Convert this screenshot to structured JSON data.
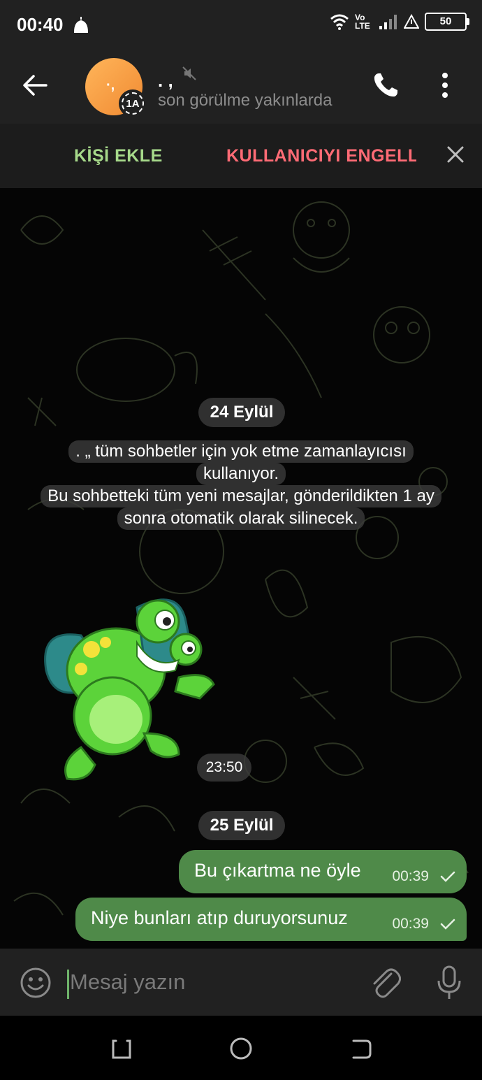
{
  "status_bar": {
    "time": "00:40",
    "network": "Vo LTE",
    "battery": "50"
  },
  "header": {
    "contact_name": ". ,",
    "avatar_initials": "·,",
    "timer_label": "1A",
    "status": "son görülme yakınlarda"
  },
  "action_bar": {
    "add_contact": "KİŞİ EKLE",
    "block_user": "KULLANICIYI ENGELLE"
  },
  "chat": {
    "date_1": "24 Eylül",
    "system_message_lines": [
      ". „ tüm sohbetler için yok etme zamanlayıcısı",
      "kullanıyor.",
      "Bu sohbetteki tüm yeni mesajlar, gönderildikten 1 ay",
      "sonra otomatik olarak silinecek."
    ],
    "sticker_time": "23:50",
    "date_2": "25 Eylül",
    "messages": [
      {
        "text": "Bu çıkartma ne öyle",
        "time": "00:39",
        "status": "sent"
      },
      {
        "text": "Niye bunları atıp duruyorsunuz",
        "time": "00:39",
        "status": "sent"
      }
    ]
  },
  "composer": {
    "placeholder": "Mesaj yazın"
  },
  "colors": {
    "bubble_out": "#4f8a49",
    "add_contact": "#a6d98a",
    "block_user": "#ff6b75",
    "bar": "#212121"
  }
}
